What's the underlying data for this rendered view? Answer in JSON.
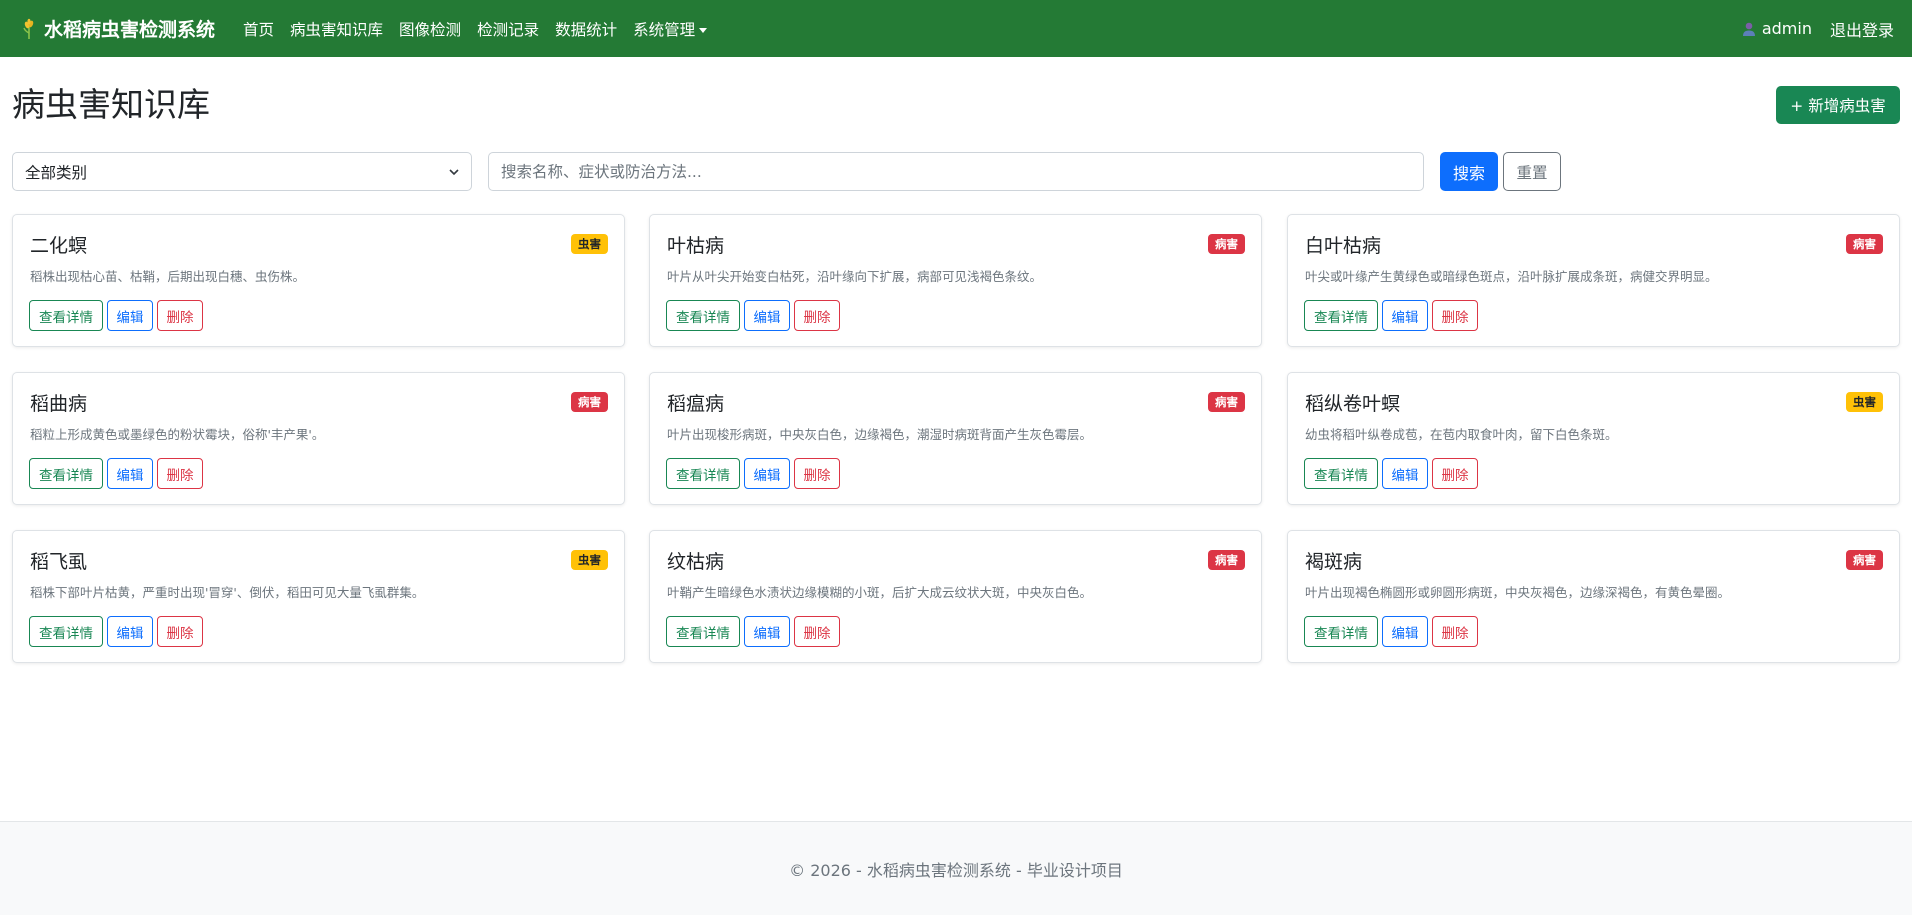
{
  "navbar": {
    "brand": "水稻病虫害检测系统",
    "links": [
      "首页",
      "病虫害知识库",
      "图像检测",
      "检测记录",
      "数据统计",
      "系统管理"
    ],
    "user": "admin",
    "logout": "退出登录"
  },
  "page": {
    "title": "病虫害知识库",
    "add_button": "+ 新增病虫害"
  },
  "filters": {
    "category_selected": "全部类别",
    "search_placeholder": "搜索名称、症状或防治方法...",
    "search_button": "搜索",
    "reset_button": "重置"
  },
  "card_actions": {
    "view": "查看详情",
    "edit": "编辑",
    "delete": "删除"
  },
  "cards": [
    {
      "title": "二化螟",
      "badge": "虫害",
      "type": "pest",
      "desc": "稻株出现枯心苗、枯鞘，后期出现白穗、虫伤株。"
    },
    {
      "title": "叶枯病",
      "badge": "病害",
      "type": "disease",
      "desc": "叶片从叶尖开始变白枯死，沿叶缘向下扩展，病部可见浅褐色条纹。"
    },
    {
      "title": "白叶枯病",
      "badge": "病害",
      "type": "disease",
      "desc": "叶尖或叶缘产生黄绿色或暗绿色斑点，沿叶脉扩展成条斑，病健交界明显。"
    },
    {
      "title": "稻曲病",
      "badge": "病害",
      "type": "disease",
      "desc": "稻粒上形成黄色或墨绿色的粉状霉块，俗称'丰产果'。"
    },
    {
      "title": "稻瘟病",
      "badge": "病害",
      "type": "disease",
      "desc": "叶片出现梭形病斑，中央灰白色，边缘褐色，潮湿时病斑背面产生灰色霉层。"
    },
    {
      "title": "稻纵卷叶螟",
      "badge": "虫害",
      "type": "pest",
      "desc": "幼虫将稻叶纵卷成苞，在苞内取食叶肉，留下白色条斑。"
    },
    {
      "title": "稻飞虱",
      "badge": "虫害",
      "type": "pest",
      "desc": "稻株下部叶片枯黄，严重时出现'冒穿'、倒伏，稻田可见大量飞虱群集。"
    },
    {
      "title": "纹枯病",
      "badge": "病害",
      "type": "disease",
      "desc": "叶鞘产生暗绿色水渍状边缘模糊的小斑，后扩大成云纹状大斑，中央灰白色。"
    },
    {
      "title": "褐斑病",
      "badge": "病害",
      "type": "disease",
      "desc": "叶片出现褐色椭圆形或卵圆形病斑，中央灰褐色，边缘深褐色，有黄色晕圈。"
    }
  ],
  "footer": {
    "text": "© 2026 - 水稻病虫害检测系统 - 毕业设计项目"
  },
  "colors": {
    "navbar": "#247a35",
    "primary": "#0d6efd",
    "success": "#198754",
    "danger": "#dc3545",
    "warning": "#ffc107"
  },
  "icons": {
    "brand": "rice-plant-icon",
    "user": "user-icon",
    "dropdown": "caret-down-icon",
    "select": "chevron-down-icon"
  }
}
